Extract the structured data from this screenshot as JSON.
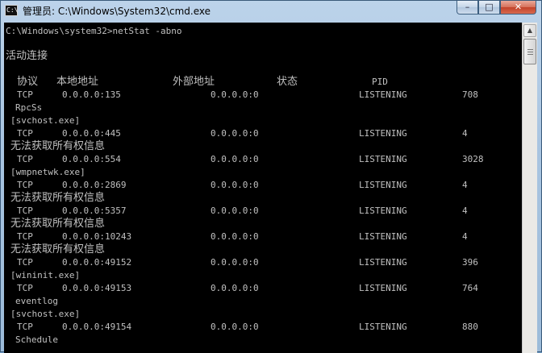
{
  "window": {
    "icon_text": "C:\\",
    "title": "管理员: C:\\Windows\\System32\\cmd.exe",
    "minimize_glyph": "–",
    "maximize_glyph": "□",
    "close_glyph": "✕"
  },
  "console": {
    "prompt_line": "C:\\Windows\\system32>netStat -abno",
    "section_title": "活动连接",
    "headers": {
      "proto": "协议",
      "local": "本地地址",
      "foreign": "外部地址",
      "state": "状态",
      "pid": "PID"
    },
    "rows": [
      {
        "proto": "TCP",
        "local": "0.0.0.0:135",
        "foreign": "0.0.0.0:0",
        "state": "LISTENING",
        "pid": "708"
      },
      {
        "note": "RpcSs"
      },
      {
        "note": "[svchost.exe]"
      },
      {
        "proto": "TCP",
        "local": "0.0.0.0:445",
        "foreign": "0.0.0.0:0",
        "state": "LISTENING",
        "pid": "4"
      },
      {
        "note": "无法获取所有权信息"
      },
      {
        "proto": "TCP",
        "local": "0.0.0.0:554",
        "foreign": "0.0.0.0:0",
        "state": "LISTENING",
        "pid": "3028"
      },
      {
        "note": "[wmpnetwk.exe]"
      },
      {
        "proto": "TCP",
        "local": "0.0.0.0:2869",
        "foreign": "0.0.0.0:0",
        "state": "LISTENING",
        "pid": "4"
      },
      {
        "note": "无法获取所有权信息"
      },
      {
        "proto": "TCP",
        "local": "0.0.0.0:5357",
        "foreign": "0.0.0.0:0",
        "state": "LISTENING",
        "pid": "4"
      },
      {
        "note": "无法获取所有权信息"
      },
      {
        "proto": "TCP",
        "local": "0.0.0.0:10243",
        "foreign": "0.0.0.0:0",
        "state": "LISTENING",
        "pid": "4"
      },
      {
        "note": "无法获取所有权信息"
      },
      {
        "proto": "TCP",
        "local": "0.0.0.0:49152",
        "foreign": "0.0.0.0:0",
        "state": "LISTENING",
        "pid": "396"
      },
      {
        "note": "[wininit.exe]"
      },
      {
        "proto": "TCP",
        "local": "0.0.0.0:49153",
        "foreign": "0.0.0.0:0",
        "state": "LISTENING",
        "pid": "764"
      },
      {
        "note": "eventlog"
      },
      {
        "note": "[svchost.exe]"
      },
      {
        "proto": "TCP",
        "local": "0.0.0.0:49154",
        "foreign": "0.0.0.0:0",
        "state": "LISTENING",
        "pid": "880"
      },
      {
        "note": "Schedule"
      }
    ]
  },
  "scrollbar": {
    "up_glyph": "▲"
  }
}
